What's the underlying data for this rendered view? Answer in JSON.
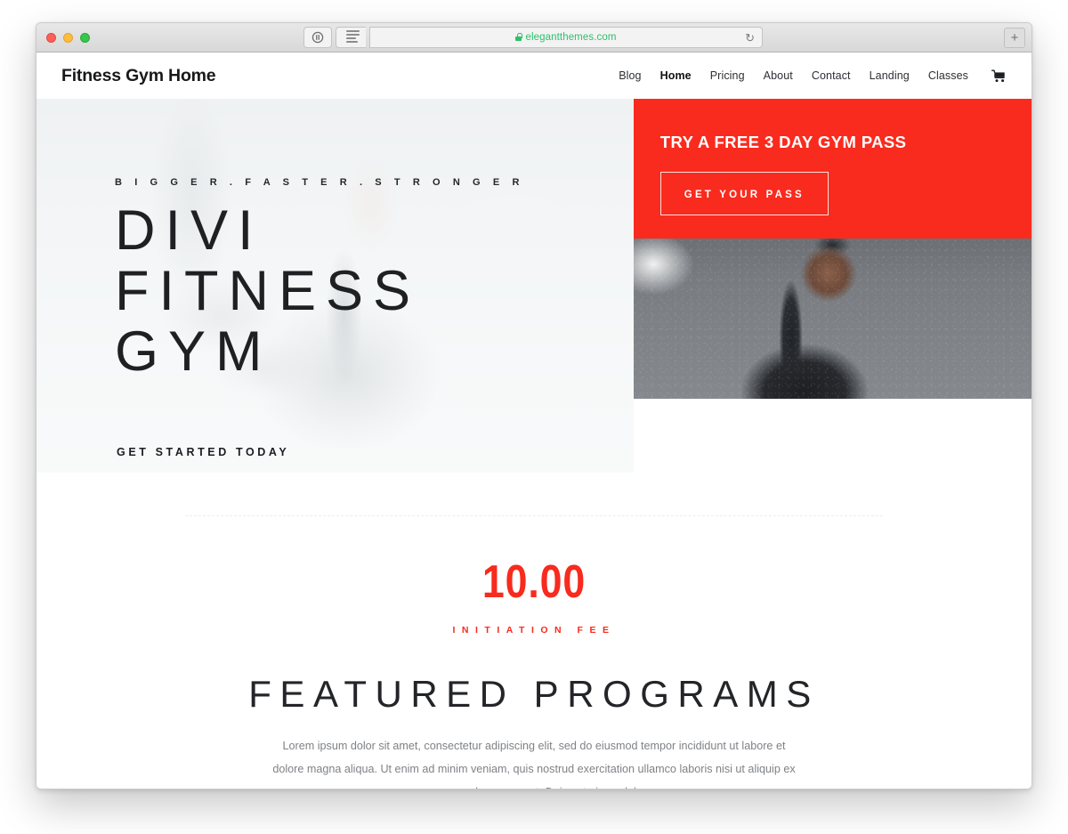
{
  "browser": {
    "url": "elegantthemes.com",
    "secure_icon": "lock-icon",
    "reader_icon": "reader-view-icon",
    "privacy_icon": "privacy-report-icon",
    "reload_icon": "↻",
    "newtab_icon": "+",
    "traffic_lights": [
      "close",
      "minimize",
      "maximize"
    ]
  },
  "site": {
    "title": "Fitness Gym Home",
    "nav": [
      {
        "label": "Blog",
        "active": false
      },
      {
        "label": "Home",
        "active": true
      },
      {
        "label": "Pricing",
        "active": false
      },
      {
        "label": "About",
        "active": false
      },
      {
        "label": "Contact",
        "active": false
      },
      {
        "label": "Landing",
        "active": false
      },
      {
        "label": "Classes",
        "active": false
      }
    ],
    "cart_icon": "shopping-cart-icon",
    "hero": {
      "eyebrow": "B I G G E R . F A S T E R . S T R O N G E R",
      "title": "DIVI FITNESS GYM",
      "cta_label": "GET STARTED TODAY"
    },
    "promo": {
      "heading": "TRY A FREE 3 DAY GYM PASS",
      "button_label": "GET YOUR PASS"
    },
    "pricing": {
      "amount": "10.00",
      "label": "INITIATION FEE"
    },
    "featured": {
      "heading": "FEATURED PROGRAMS",
      "body": "Lorem ipsum dolor sit amet, consectetur adipiscing elit, sed do eiusmod tempor incididunt ut labore et dolore magna aliqua. Ut enim ad minim veniam, quis nostrud exercitation ullamco laboris nisi ut aliquip ex ea commodo consequat. Duis aute irure dolor."
    }
  },
  "colors": {
    "accent_red": "#F92B1E",
    "text_dark": "#1E2023",
    "body_gray": "#7F8286",
    "secure_green": "#2EC06B"
  }
}
